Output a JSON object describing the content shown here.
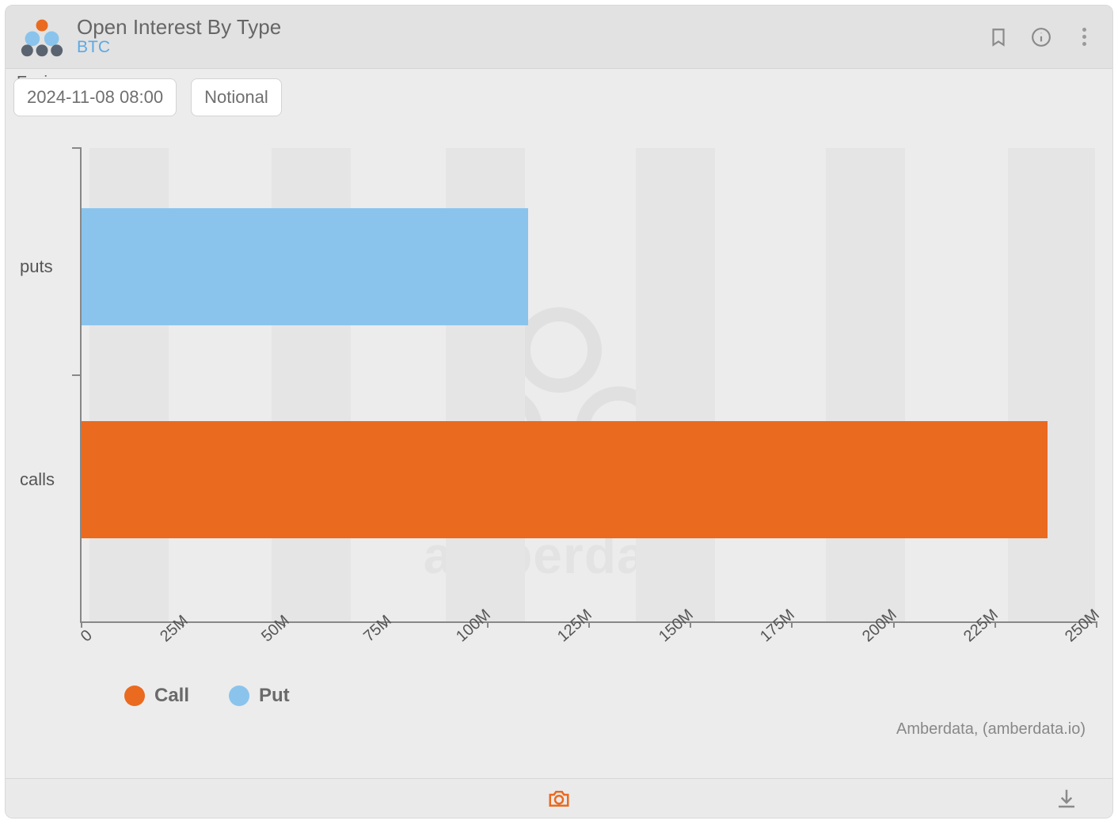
{
  "header": {
    "title": "Open Interest By Type",
    "subtitle": "BTC"
  },
  "controls": {
    "expiry_label": "Expiry",
    "expiry_value": "2024-11-08 08:00",
    "mode_value": "Notional"
  },
  "legend": {
    "call": "Call",
    "put": "Put"
  },
  "colors": {
    "call": "#ea6a1f",
    "put": "#8ac4ed"
  },
  "attribution": "Amberdata, (amberdata.io)",
  "watermark_text": "amberdata",
  "chart_data": {
    "type": "bar",
    "orientation": "horizontal",
    "categories": [
      "puts",
      "calls"
    ],
    "series": [
      {
        "name": "Put",
        "values": [
          110000000,
          0
        ],
        "color_key": "put"
      },
      {
        "name": "Call",
        "values": [
          0,
          238000000
        ],
        "color_key": "call"
      }
    ],
    "xlabel": "",
    "ylabel": "",
    "xlim": [
      0,
      250000000
    ],
    "x_ticks": [
      0,
      25000000,
      50000000,
      75000000,
      100000000,
      125000000,
      150000000,
      175000000,
      200000000,
      225000000,
      250000000
    ],
    "x_tick_labels": [
      "0",
      "25M",
      "50M",
      "75M",
      "100M",
      "125M",
      "150M",
      "175M",
      "200M",
      "225M",
      "250M"
    ]
  }
}
